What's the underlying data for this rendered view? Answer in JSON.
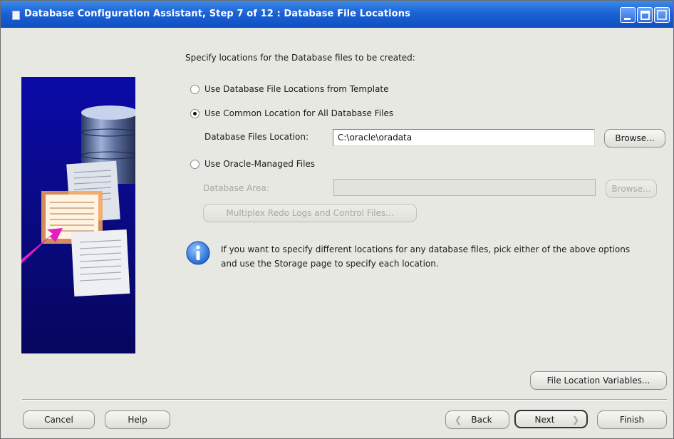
{
  "window": {
    "title": "Database Configuration Assistant, Step 7 of 12 : Database File Locations"
  },
  "main": {
    "instruction": "Specify locations for the Database files to be created:",
    "options": [
      {
        "label": "Use Database File Locations from Template",
        "selected": false
      },
      {
        "label": "Use Common Location for All Database Files",
        "selected": true
      },
      {
        "label": "Use Oracle-Managed Files",
        "selected": false
      }
    ],
    "common_location": {
      "label": "Database Files Location:",
      "value": "C:\\oracle\\oradata",
      "browse_label": "Browse..."
    },
    "managed_files": {
      "area_label": "Database Area:",
      "area_value": "",
      "browse_label": "Browse...",
      "multiplex_label": "Multiplex Redo Logs and Control Files..."
    },
    "info": {
      "icon": "info-icon",
      "text": "If you want to specify different locations for any database files, pick either of the above options and use the Storage page to specify each location."
    },
    "file_location_variables_label": "File Location Variables..."
  },
  "footer": {
    "cancel_label": "Cancel",
    "help_label": "Help",
    "back_label": "Back",
    "next_label": "Next",
    "finish_label": "Finish"
  },
  "colors": {
    "titlebar": "#1c62d6",
    "window_bg": "#e8e8e3",
    "illustration_bg": "#0a0a8a",
    "arrow": "#e020c0"
  }
}
